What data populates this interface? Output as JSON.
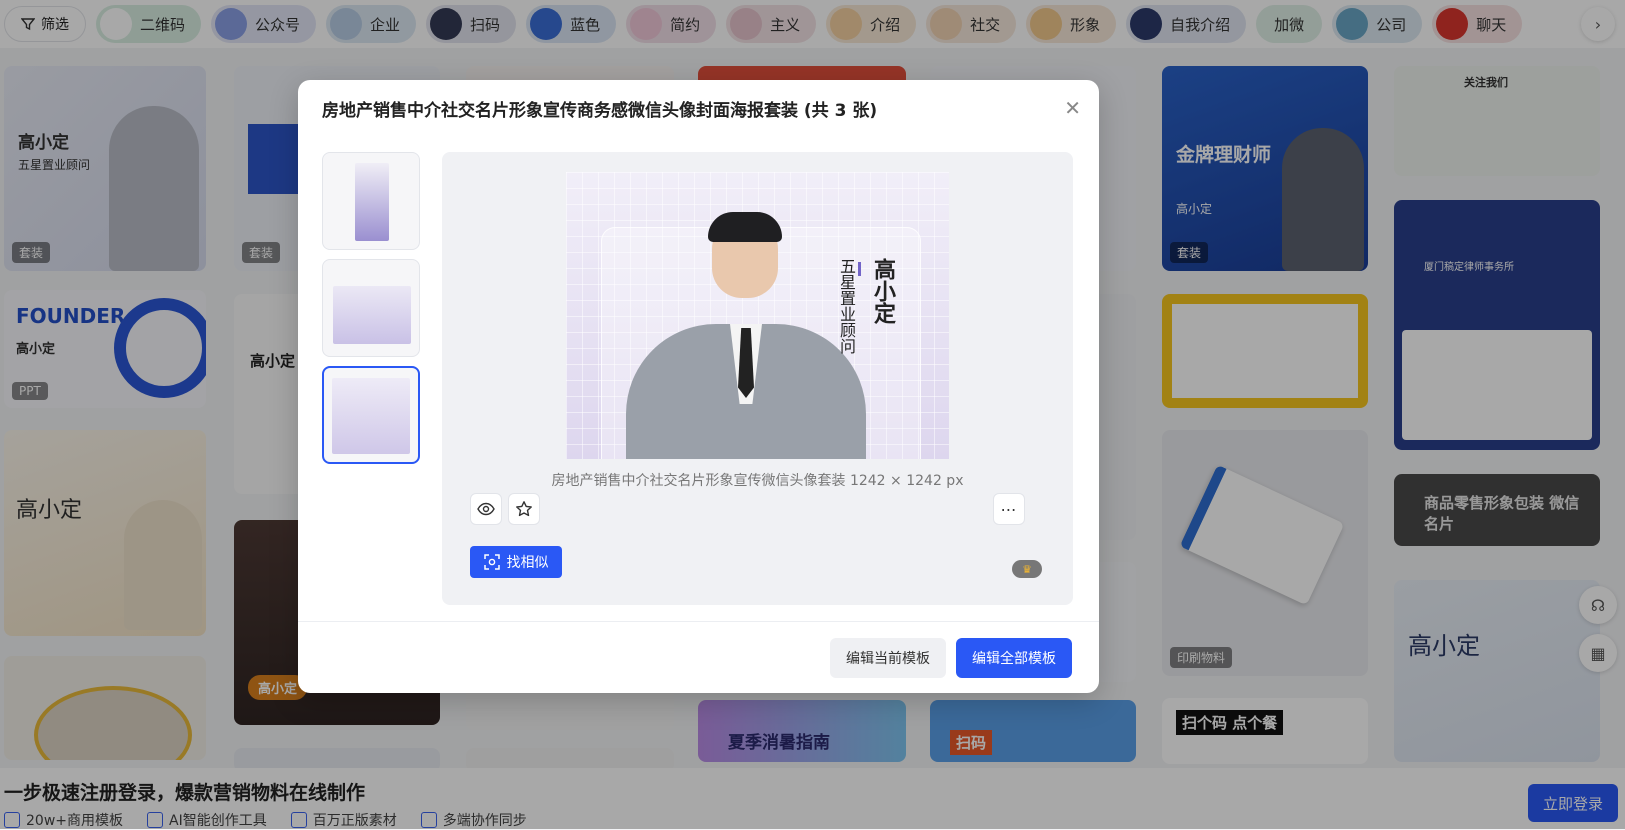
{
  "tagbar": {
    "filter_label": "筛选",
    "tags": [
      {
        "label": "二维码",
        "bg": "#d9efe3",
        "thumb": "#ffffff"
      },
      {
        "label": "公众号",
        "bg": "#e3e6f6",
        "thumb": "#8aa0e6"
      },
      {
        "label": "企业",
        "bg": "#dde8f3",
        "thumb": "#b8cde6"
      },
      {
        "label": "扫码",
        "bg": "#e3e4ee",
        "thumb": "#343a55"
      },
      {
        "label": "蓝色",
        "bg": "#dbe6f5",
        "thumb": "#3a6ed6"
      },
      {
        "label": "简约",
        "bg": "#f2dfe9",
        "thumb": "#f1c9da"
      },
      {
        "label": "主义",
        "bg": "#f3e2e6",
        "thumb": "#e7c4cd"
      },
      {
        "label": "介绍",
        "bg": "#f8e9d6",
        "thumb": "#f4d1a1"
      },
      {
        "label": "社交",
        "bg": "#f6e8dc",
        "thumb": "#f1d3b4"
      },
      {
        "label": "形象",
        "bg": "#f7e8d9",
        "thumb": "#f2c98c"
      },
      {
        "label": "自我介绍",
        "bg": "#e1e6f2",
        "thumb": "#2c3a6b"
      },
      {
        "label": "加微",
        "bg": "#dff0e7",
        "thumb": ""
      },
      {
        "label": "公司",
        "bg": "#dce9f1",
        "thumb": "#6aa6c5"
      },
      {
        "label": "聊天",
        "bg": "#f6e1e1",
        "thumb": "#d9362e"
      }
    ]
  },
  "background_cards": {
    "badge_suite": "套装",
    "badge_ppt": "PPT",
    "badge_print": "印刷物料",
    "name": "高小定",
    "title_five_star": "五星置业顾问",
    "founder": "FOUNDER",
    "gold_advisor": "金牌理财师",
    "follow_us": "关注我们",
    "summer": "夏季消暑指南",
    "scan_order": "扫个码 点个餐",
    "scan": "扫码",
    "retail_search": "商品零售形象包装 微信名片",
    "law_firm": "厦门稿定律师事务所"
  },
  "modal": {
    "title": "房地产销售中介社交名片形象宣传商务感微信头像封面海报套装 (共 3 张)",
    "preview": {
      "name": "高小定",
      "role": "五星置业顾问",
      "caption": "房地产销售中介社交名片形象宣传微信头像套装 1242 × 1242 px"
    },
    "find_similar_label": "找相似",
    "edit_current_label": "编辑当前模板",
    "edit_all_label": "编辑全部模板"
  },
  "banner": {
    "title": "一步极速注册登录，爆款营销物料在线制作",
    "features": [
      "20w+商用模板",
      "AI智能创作工具",
      "百万正版素材",
      "多端协作同步"
    ],
    "login_label": "立即登录"
  },
  "colors": {
    "accent": "#2a58f5",
    "overlay": "rgba(0,0,0,0.34)"
  }
}
